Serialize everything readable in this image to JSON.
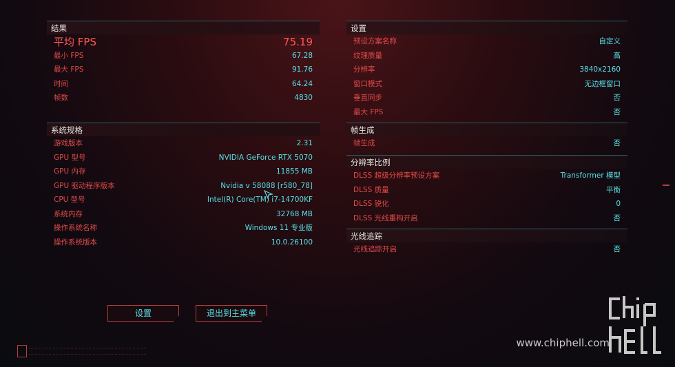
{
  "results": {
    "title": "结果",
    "avg_fps": {
      "label": "平均 FPS",
      "value": "75.19"
    },
    "rows": [
      {
        "label": "最小 FPS",
        "value": "67.28"
      },
      {
        "label": "最大 FPS",
        "value": "91.76"
      },
      {
        "label": "时间",
        "value": "64.24"
      },
      {
        "label": "帧数",
        "value": "4830"
      }
    ]
  },
  "system": {
    "title": "系统规格",
    "rows": [
      {
        "label": "游戏版本",
        "value": "2.31"
      },
      {
        "label": "GPU 型号",
        "value": "NVIDIA GeForce RTX 5070"
      },
      {
        "label": "GPU 内存",
        "value": "11855 MB"
      },
      {
        "label": "GPU 驱动程序版本",
        "value": "Nvidia v 58088 [r580_78]"
      },
      {
        "label": "CPU 型号",
        "value": "Intel(R) Core(TM) i7-14700KF"
      },
      {
        "label": "系统内存",
        "value": "32768 MB"
      },
      {
        "label": "操作系统名称",
        "value": "Windows 11 专业版"
      },
      {
        "label": "操作系统版本",
        "value": "10.0.26100"
      }
    ]
  },
  "settings": {
    "title": "设置",
    "rows": [
      {
        "label": "预设方案名称",
        "value": "自定义"
      },
      {
        "label": "纹理质量",
        "value": "高"
      },
      {
        "label": "分辨率",
        "value": "3840x2160"
      },
      {
        "label": "窗口模式",
        "value": "无边框窗口"
      },
      {
        "label": "垂直同步",
        "value": "否"
      },
      {
        "label": "最大 FPS",
        "value": "否"
      }
    ]
  },
  "frame_gen": {
    "title": "帧生成",
    "rows": [
      {
        "label": "帧生成",
        "value": "否"
      }
    ]
  },
  "resolution_scaling": {
    "title": "分辨率比例",
    "rows": [
      {
        "label": "DLSS 超级分辨率预设方案",
        "value": "Transformer 模型"
      },
      {
        "label": "DLSS 质量",
        "value": "平衡"
      },
      {
        "label": "DLSS 锐化",
        "value": "0"
      },
      {
        "label": "DLSS 光线重构开启",
        "value": "否"
      }
    ]
  },
  "ray_tracing": {
    "title": "光线追踪",
    "rows": [
      {
        "label": "光线追踪开启",
        "value": "否"
      }
    ]
  },
  "buttons": {
    "settings": "设置",
    "exit_to_main": "退出到主菜单"
  },
  "watermark": "www.chiphell.com",
  "logo_text": "chip hell",
  "colors": {
    "label_red": "#e14a4a",
    "value_cyan": "#58e0e6",
    "header_line": "#2f5d66",
    "button_border": "#b83c3c"
  }
}
